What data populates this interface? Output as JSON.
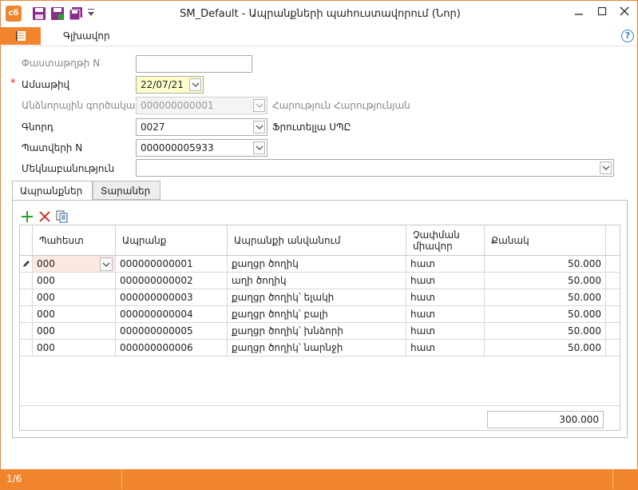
{
  "window": {
    "title": "SM_Default - Ապրանքների պահուստավորում (Նոր)",
    "logo_text": "cб"
  },
  "ribbon": {
    "home_tab": "Գլխավոր",
    "help": "?"
  },
  "form": {
    "doc_number_label": "Փաստաթղթի N",
    "doc_number_value": "",
    "date_label": "Ամսաթիվ",
    "date_required_mark": "*",
    "date_value": "22/07/21",
    "responsible_label": "Անձնորային գործակալ",
    "responsible_value": "000000000001",
    "responsible_name": "Հարություն Հարությունյան",
    "buyer_label": "Գնորդ",
    "buyer_value": "0027",
    "buyer_name": "Ֆրուտելլա ՍՊԸ",
    "order_label": "Պատվերի N",
    "order_value": "000000005933",
    "comment_label": "Մեկնաբանություն",
    "comment_value": ""
  },
  "tabs": [
    {
      "label": "Ապրանքներ",
      "active": true
    },
    {
      "label": "Տարաներ",
      "active": false
    }
  ],
  "grid": {
    "columns": [
      "Պահեստ",
      "Ապրանք",
      "Ապրանքի անվանում",
      "Չափման միավոր",
      "Քանակ"
    ],
    "rows": [
      {
        "warehouse": "000",
        "item": "000000000001",
        "name": "քաղցր ծողիկ",
        "unit": "հատ",
        "qty": "50.000"
      },
      {
        "warehouse": "000",
        "item": "000000000002",
        "name": "աղի ծողիկ",
        "unit": "հատ",
        "qty": "50.000"
      },
      {
        "warehouse": "000",
        "item": "000000000003",
        "name": "քաղցր ծողիկ՝ ելակի",
        "unit": "հատ",
        "qty": "50.000"
      },
      {
        "warehouse": "000",
        "item": "000000000004",
        "name": "քաղցր ծողիկ՝ բալի",
        "unit": "հատ",
        "qty": "50.000"
      },
      {
        "warehouse": "000",
        "item": "000000000005",
        "name": "քաղցր ծողիկ՝ խնձորի",
        "unit": "հատ",
        "qty": "50.000"
      },
      {
        "warehouse": "000",
        "item": "000000000006",
        "name": "քաղցր ծողիկ՝ նարնջի",
        "unit": "հատ",
        "qty": "50.000"
      }
    ],
    "total_qty": "300.000"
  },
  "status": {
    "page": "1/6"
  },
  "colors": {
    "accent": "#f0852d",
    "save_icon": "#8a2a8a",
    "add_icon": "#2e9c2e",
    "delete_icon": "#d43a2a"
  }
}
